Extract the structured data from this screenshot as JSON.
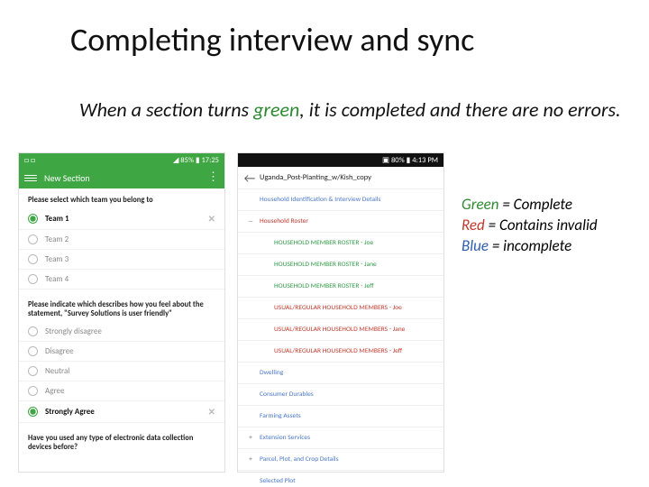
{
  "title": "Completing interview and sync",
  "subtitle_pre": "When a section turns ",
  "subtitle_green": "green",
  "subtitle_post": ", it is completed and there are no errors.",
  "legend": {
    "g_pre": "Green",
    "g_post": " = Complete",
    "r_pre": "Red",
    "r_post": " = Contains invalid",
    "b_pre": "Blue",
    "b_post": " = incomplete"
  },
  "phone1": {
    "status_left": "□ □",
    "status_right": "◢ 85% ▮ 17:25",
    "topbar": "New Section",
    "q1": "Please select which team you belong to",
    "q1_options": [
      "Team 1",
      "Team 2",
      "Team 3",
      "Team 4"
    ],
    "q1_selected": 0,
    "q2": "Please indicate which describes how you feel about the statement, \"Survey Solutions is user friendly\"",
    "q2_options": [
      "Strongly disagree",
      "Disagree",
      "Neutral",
      "Agree",
      "Strongly Agree"
    ],
    "q2_selected": 4,
    "q3": "Have you used any type of electronic data collection devices before?"
  },
  "phone2": {
    "status_right": "▣ 80% ▮ 4:13 PM",
    "topbar": "Uganda_Post-Planting_w/Kish_copy",
    "sections": [
      {
        "label": "Household Identification & Interview Details",
        "color": "blue",
        "toggle": ""
      },
      {
        "label": "Household Roster",
        "color": "red",
        "toggle": "—"
      },
      {
        "label": "HOUSEHOLD MEMBER ROSTER - Joe",
        "color": "green",
        "toggle": "",
        "sub": true
      },
      {
        "label": "HOUSEHOLD MEMBER ROSTER - Jane",
        "color": "green",
        "toggle": "",
        "sub": true
      },
      {
        "label": "HOUSEHOLD MEMBER ROSTER - Jeff",
        "color": "green",
        "toggle": "",
        "sub": true
      },
      {
        "label": "USUAL/REGULAR HOUSEHOLD MEMBERS - Joe",
        "color": "red",
        "toggle": "",
        "sub": true
      },
      {
        "label": "USUAL/REGULAR HOUSEHOLD MEMBERS - Jane",
        "color": "red",
        "toggle": "",
        "sub": true
      },
      {
        "label": "USUAL/REGULAR HOUSEHOLD MEMBERS - Jeff",
        "color": "red",
        "toggle": "",
        "sub": true
      },
      {
        "label": "Dwelling",
        "color": "blue",
        "toggle": ""
      },
      {
        "label": "Consumer Durables",
        "color": "blue",
        "toggle": ""
      },
      {
        "label": "Farming Assets",
        "color": "blue",
        "toggle": ""
      },
      {
        "label": "Extension Services",
        "color": "blue",
        "toggle": "+"
      },
      {
        "label": "Parcel, Plot, and Crop Details",
        "color": "blue",
        "toggle": "+"
      },
      {
        "label": "Selected Plot",
        "color": "blue",
        "toggle": ""
      }
    ]
  }
}
